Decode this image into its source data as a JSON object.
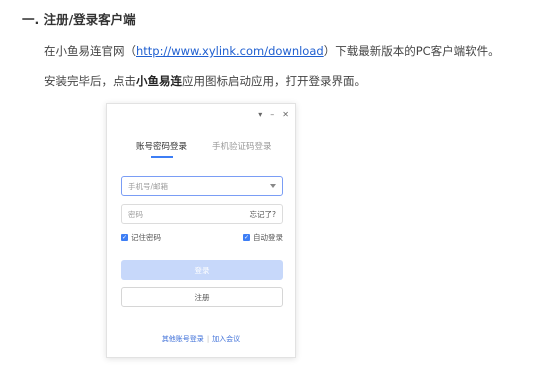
{
  "doc": {
    "heading": "一. 注册/登录客户端",
    "para1_before": "在小鱼易连官网（",
    "para1_link": "http://www.xylink.com/download",
    "para1_after": "）下载最新版本的PC客户端软件。",
    "para2_before": "安装完毕后，点击",
    "para2_bold": "小鱼易连",
    "para2_after": "应用图标启动应用，打开登录界面。"
  },
  "login": {
    "window_controls": {
      "menu_icon": "▾",
      "minimize_icon": "–",
      "close_icon": "✕"
    },
    "tabs": [
      {
        "label": "账号密码登录",
        "active": true
      },
      {
        "label": "手机验证码登录",
        "active": false
      }
    ],
    "account_placeholder": "手机号/邮箱",
    "password_placeholder": "密码",
    "forgot_label": "忘记了?",
    "remember_label": "记住密码",
    "remember_checked": true,
    "auto_login_label": "自动登录",
    "auto_login_checked": true,
    "login_button": "登录",
    "register_button": "注册",
    "footer_other": "其他账号登录",
    "footer_separator": "|",
    "footer_join": "加入会议",
    "accent_color": "#3d7ef5"
  }
}
